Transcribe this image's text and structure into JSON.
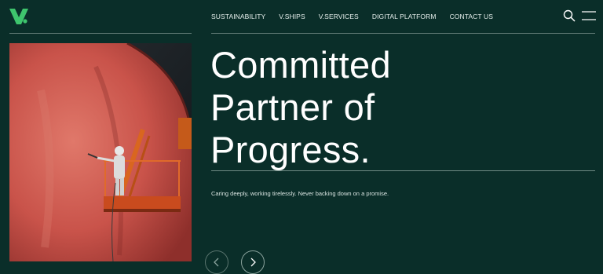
{
  "header": {
    "logo_name": "brand-logo",
    "nav": [
      {
        "label": "SUSTAINABILITY"
      },
      {
        "label": "V.SHIPS"
      },
      {
        "label": "V.SERVICES"
      },
      {
        "label": "DIGITAL PLATFORM"
      },
      {
        "label": "CONTACT US"
      }
    ],
    "icons": {
      "search": "search-icon",
      "menu": "menu-icon"
    }
  },
  "hero": {
    "headline_lines": [
      "Committed",
      "Partner of",
      "Progress."
    ],
    "tagline": "Caring deeply, working tirelessly. Never backing down on a promise.",
    "image": "ship-hull-painting-photo",
    "carousel": {
      "prev": "chevron-left-icon",
      "next": "chevron-right-icon"
    }
  },
  "colors": {
    "background": "#0a2e29",
    "brand_green": "#3ec46d",
    "text": "#ffffff"
  }
}
